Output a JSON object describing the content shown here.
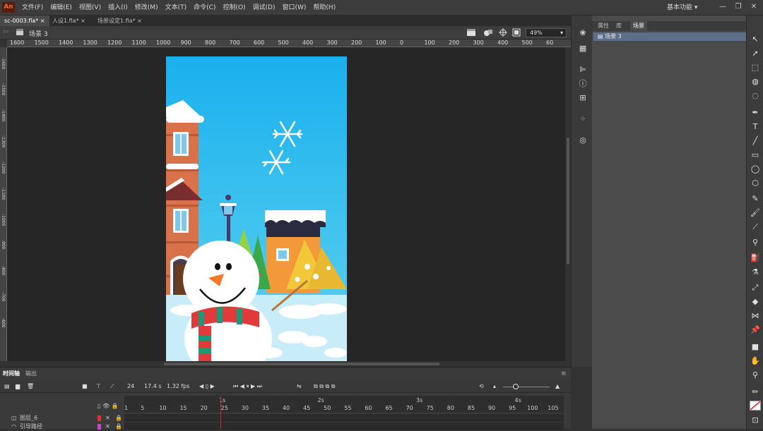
{
  "app": {
    "logo": "An"
  },
  "menu": [
    "文件(F)",
    "编辑(E)",
    "视图(V)",
    "插入(I)",
    "修改(M)",
    "文本(T)",
    "命令(C)",
    "控制(O)",
    "调试(D)",
    "窗口(W)",
    "帮助(H)"
  ],
  "workspace": "基本功能",
  "window_controls": [
    "—",
    "❐",
    "✕"
  ],
  "tabs": [
    "sc-0003.fla*",
    "人设1.fla*",
    "场景设定1.fla*"
  ],
  "tab_close": "×",
  "scene": {
    "name": "场景 3",
    "zoom": "49%"
  },
  "ruler_labels": [
    "1600",
    "1500",
    "1400",
    "1300",
    "1200",
    "1100",
    "1000",
    "900",
    "800",
    "700",
    "600",
    "500",
    "400",
    "300",
    "200",
    "100",
    "0",
    "100",
    "200",
    "300",
    "400",
    "500",
    "60"
  ],
  "vruler_labels": [
    "-1600",
    "-1500",
    "-1400",
    "-1300",
    "-1200",
    "-1100",
    "-1000",
    "-900",
    "-800",
    "-700",
    "-600"
  ],
  "right_panel": {
    "tabs": [
      "属性",
      "库",
      "场景"
    ],
    "active": "场景",
    "scenes": [
      "场景 3"
    ]
  },
  "timeline": {
    "tabs": [
      "时间轴",
      "输出"
    ],
    "fps_frame": "24",
    "time": "17.4 s",
    "fps": "1.32 fps",
    "frame_numbers": [
      "1",
      "5",
      "10",
      "15",
      "20",
      "25",
      "30",
      "35",
      "40",
      "45",
      "50",
      "55",
      "60",
      "65",
      "70",
      "75",
      "80",
      "85",
      "90",
      "95",
      "100",
      "105"
    ],
    "seconds": [
      "1s",
      "2s",
      "3s",
      "4s"
    ],
    "layers": [
      {
        "name": "图层_6"
      },
      {
        "name": "引导路径"
      }
    ]
  },
  "colors": {
    "stage_sky": "#1bb2ee",
    "playhead": "#d0252a",
    "app_logo_bg": "#5a1a10",
    "app_logo_fg": "#e36f2a"
  }
}
